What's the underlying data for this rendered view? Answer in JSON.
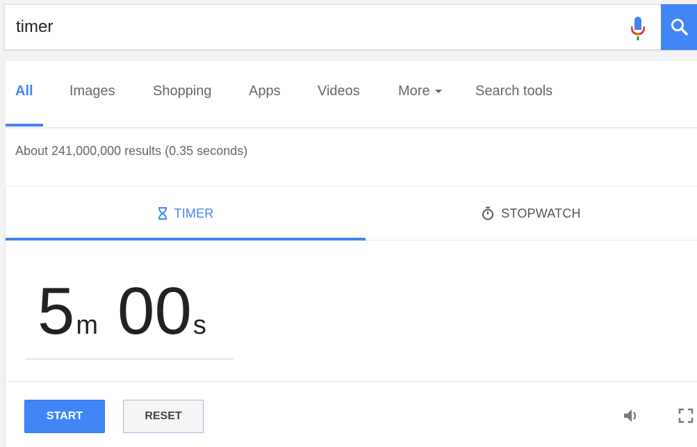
{
  "search": {
    "query": "timer"
  },
  "nav": {
    "items": [
      {
        "label": "All"
      },
      {
        "label": "Images"
      },
      {
        "label": "Shopping"
      },
      {
        "label": "Apps"
      },
      {
        "label": "Videos"
      },
      {
        "label": "More"
      },
      {
        "label": "Search tools"
      }
    ]
  },
  "results": {
    "stats": "About 241,000,000 results (0.35 seconds)"
  },
  "timer_card": {
    "tabs": [
      {
        "label": "TIMER",
        "icon": "hourglass-icon"
      },
      {
        "label": "STOPWATCH",
        "icon": "stopwatch-icon"
      }
    ],
    "minutes": "5",
    "minutes_unit": "m",
    "seconds": "00",
    "seconds_unit": "s",
    "start_label": "START",
    "reset_label": "RESET"
  },
  "colors": {
    "accent": "#4285f4",
    "nav_text": "#666666",
    "background": "#f2f2f2"
  }
}
